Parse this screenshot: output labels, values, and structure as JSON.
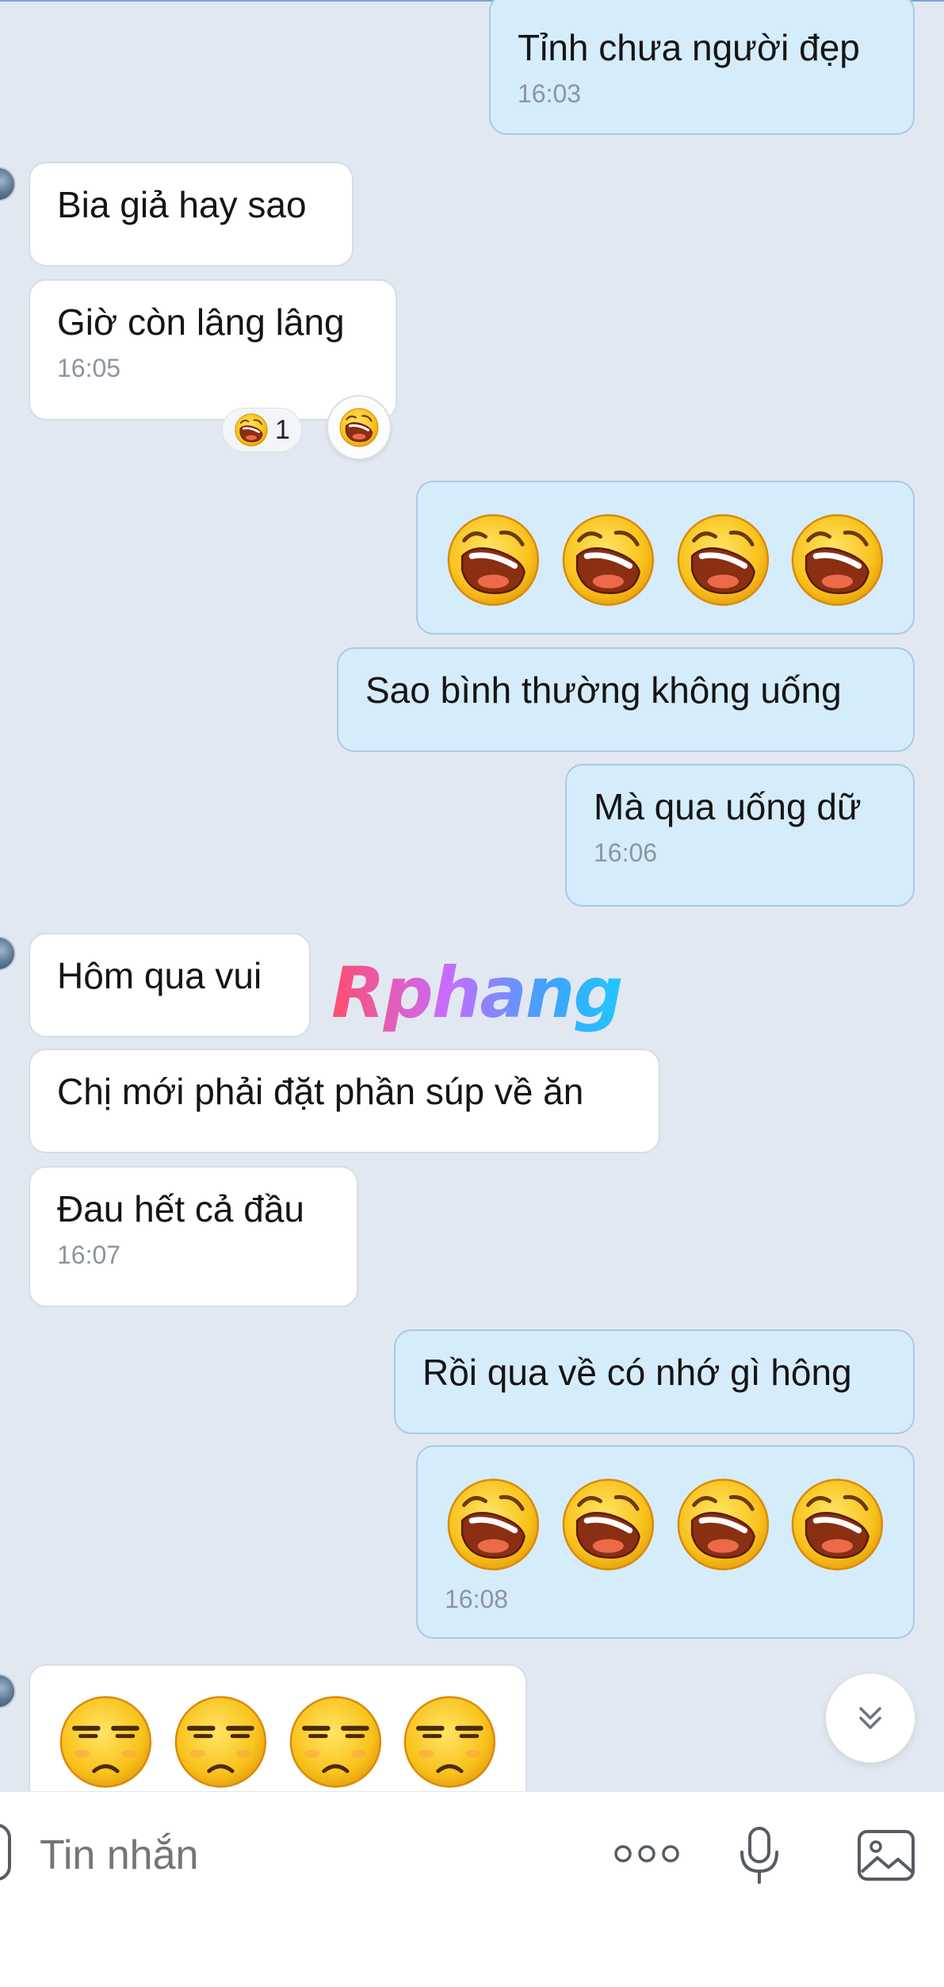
{
  "messages": [
    {
      "id": "m1",
      "direction": "out",
      "text": "Tỉnh chưa người đẹp",
      "time": "16:03"
    },
    {
      "id": "m2",
      "direction": "in",
      "text": "Bia giả hay sao"
    },
    {
      "id": "m3",
      "direction": "in",
      "text": "Giờ còn lâng lâng",
      "time": "16:05",
      "reaction": {
        "emoji": "laughing-face",
        "count": "1"
      }
    },
    {
      "id": "m4",
      "direction": "out",
      "emojis": [
        "laughing-face",
        "laughing-face",
        "laughing-face",
        "laughing-face"
      ]
    },
    {
      "id": "m5",
      "direction": "out",
      "text": "Sao bình thường không uống"
    },
    {
      "id": "m6",
      "direction": "out",
      "text": "Mà qua uống dữ",
      "time": "16:06"
    },
    {
      "id": "m7",
      "direction": "in",
      "text": "Hôm qua vui"
    },
    {
      "id": "m8",
      "direction": "in",
      "text": "Chị mới phải đặt phần súp về ăn"
    },
    {
      "id": "m9",
      "direction": "in",
      "text": "Đau hết cả đầu",
      "time": "16:07"
    },
    {
      "id": "m10",
      "direction": "out",
      "text": "Rồi qua về có nhớ gì hông"
    },
    {
      "id": "m11",
      "direction": "out",
      "emojis": [
        "laughing-face",
        "laughing-face",
        "laughing-face",
        "laughing-face"
      ],
      "time": "16:08"
    },
    {
      "id": "m12",
      "direction": "in",
      "emojis": [
        "unamused-face",
        "unamused-face",
        "unamused-face",
        "unamused-face"
      ]
    }
  ],
  "watermark": "Rphang",
  "composer": {
    "placeholder": "Tin nhắn",
    "icons": [
      "more-dots-icon",
      "microphone-icon",
      "image-icon"
    ]
  },
  "colors": {
    "background": "#e2e8f1",
    "outgoing_bubble": "#d5ecfb",
    "incoming_bubble": "#ffffff",
    "time_text": "#8c959f"
  }
}
